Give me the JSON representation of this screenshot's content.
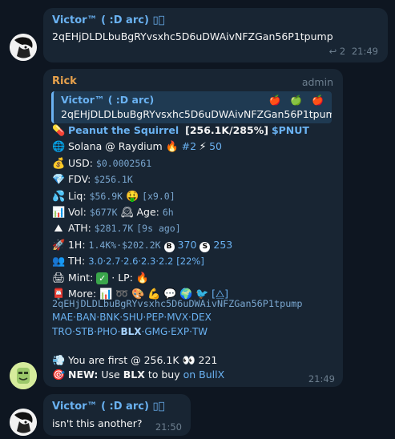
{
  "msg1": {
    "sender": "Victor™ ( :D arc)",
    "sender_icon": "book-icon",
    "text": "2qEHjDLDLbuBgRYvsxhc5D6uDWAivNFZGan56P1tpump",
    "reply_count": "2",
    "time": "21:49"
  },
  "msg2": {
    "sender": "Rick",
    "role": "admin",
    "quote": {
      "sender": "Victor™ ( :D arc)",
      "text": "2qEHjDLDLbuBgRYvsxhc5D6uDWAivNFZGan56P1tpump"
    },
    "token_line": {
      "name": "Peanut the Squirrel",
      "stats": "[256.1K/285%]",
      "ticker": "$PNUT"
    },
    "chain": "Solana @ Raydium",
    "rank": "#2",
    "rank_score": "50",
    "usd_label": "USD:",
    "usd_value": "$0.0002561",
    "fdv_label": "FDV:",
    "fdv_value": "$256.1K",
    "liq_label": "Liq:",
    "liq_value": "$56.9K",
    "liq_mult": "[x9.0]",
    "vol_label": "Vol:",
    "vol_value": "$677K",
    "age_label": "Age:",
    "age_value": "6h",
    "ath_label": "ATH:",
    "ath_value": "$281.7K",
    "ath_ago": "[9s ago]",
    "h1_label": "1H:",
    "h1_pct": "1.4K%",
    "h1_sep": "·",
    "h1_vol": "$202.2K",
    "h1_buys": "370",
    "h1_sells": "253",
    "th_label": "TH:",
    "th_values": "3.0·2.7·2.6·2.3·2.2",
    "th_total": "[22%]",
    "mint_label": "Mint:",
    "lp_label": "· LP:",
    "more_label": "More:",
    "more_bracket": "[⧋]",
    "address": "2qEHjDLDLbuBgRYvsxhc5D6uDWAivNFZGan56P1tpump",
    "links_row1": "MAE·BAN·BNK·SHU·PEP·MVX·DEX",
    "links_row2_a": "TRO·STB·PHO·",
    "links_row2_b": "BLX",
    "links_row2_c": "·GMG·EXP·TW",
    "first_text": "You are first @ 256.1K",
    "first_count": "221",
    "new_label": "NEW:",
    "new_text_a": "Use",
    "new_text_b": "BLX",
    "new_text_c": "to buy",
    "new_link": "on BullX",
    "time": "21:49"
  },
  "msg3": {
    "sender": "Victor™ ( :D arc)",
    "text": "isn't this another?",
    "time": "21:50"
  }
}
